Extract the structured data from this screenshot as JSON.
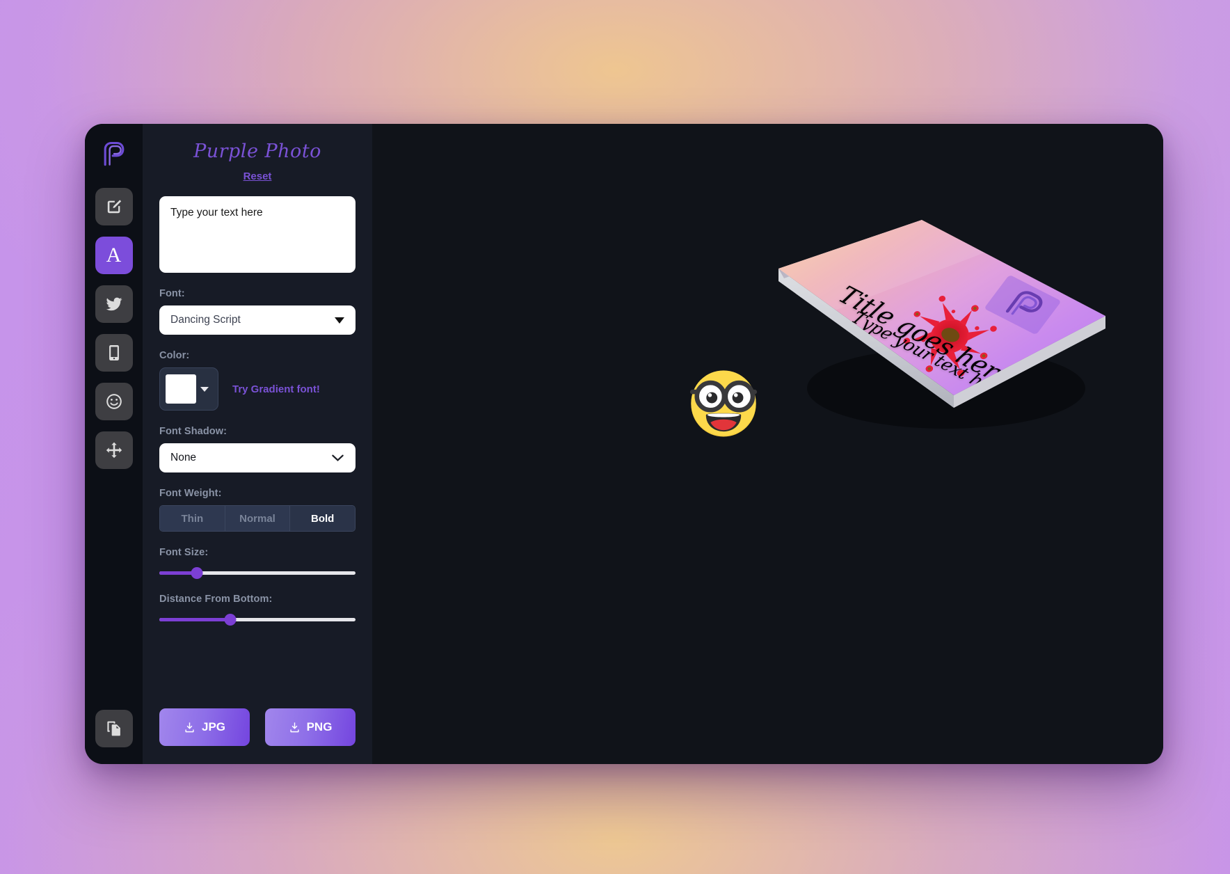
{
  "app": {
    "title": "Purple Photo",
    "reset_label": "Reset",
    "logo_icon": "purple-photo-p-logo"
  },
  "rail": {
    "items": [
      {
        "icon": "pencil-square-edit-icon",
        "name": "edit-image",
        "active": false
      },
      {
        "icon": "letter-a-text-icon",
        "name": "text-tool",
        "active": true
      },
      {
        "icon": "twitter-bird-icon",
        "name": "twitter-tool",
        "active": false
      },
      {
        "icon": "mobile-phone-icon",
        "name": "mobile-preview",
        "active": false
      },
      {
        "icon": "smiley-face-icon",
        "name": "emoji-tool",
        "active": false
      },
      {
        "icon": "move-arrows-icon",
        "name": "move-tool",
        "active": false
      }
    ],
    "bottom_item": {
      "icon": "copy-documents-icon",
      "name": "duplicate-templates"
    }
  },
  "panel": {
    "text_input": {
      "label": "",
      "value": "Type your text here",
      "placeholder": "Type your text here"
    },
    "font": {
      "label": "Font:",
      "selected": "Dancing Script",
      "options": [
        "Dancing Script"
      ]
    },
    "color": {
      "label": "Color:",
      "swatch_hex": "#ffffff",
      "gradient_link": "Try Gradient font!"
    },
    "font_shadow": {
      "label": "Font Shadow:",
      "selected": "None",
      "options": [
        "None"
      ]
    },
    "font_weight": {
      "label": "Font Weight:",
      "options": [
        "Thin",
        "Normal",
        "Bold"
      ],
      "selected": "Bold"
    },
    "font_size": {
      "label": "Font Size:",
      "percent": 19
    },
    "distance_from_bottom": {
      "label": "Distance From Bottom:",
      "percent": 36
    },
    "downloads": [
      {
        "label": "JPG",
        "icon": "download-icon"
      },
      {
        "label": "PNG",
        "icon": "download-icon"
      }
    ]
  },
  "canvas": {
    "emoji": {
      "name": "nerd-face-emoji",
      "glyph": "nerd-face"
    },
    "book": {
      "title_text": "Title goes here",
      "subtitle_text": "Type your text here",
      "splatter": "red-paint-splatter",
      "watermark": "purple-photo-p-logo"
    }
  },
  "colors": {
    "accent_purple": "#7a52d6",
    "panel_bg": "#171b26",
    "canvas_bg": "#101319",
    "rail_bg": "#0c0f16",
    "slider_fill": "#7c3fd4"
  }
}
